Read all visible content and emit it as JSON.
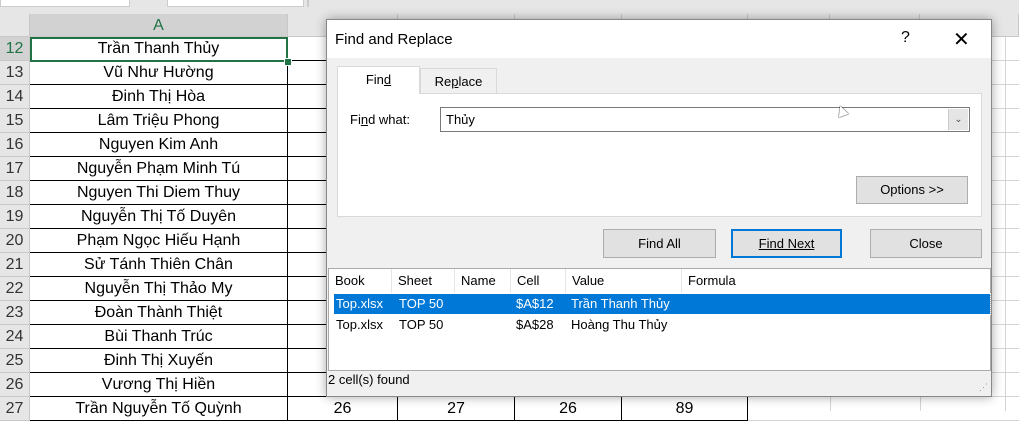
{
  "sheet": {
    "column_header": "A",
    "rows": [
      {
        "num": "12",
        "name": "Trần Thanh Thủy"
      },
      {
        "num": "13",
        "name": "Vũ Như Hường"
      },
      {
        "num": "14",
        "name": "Đinh Thị Hòa"
      },
      {
        "num": "15",
        "name": "Lâm Triệu Phong"
      },
      {
        "num": "16",
        "name": "Nguyen Kim Anh"
      },
      {
        "num": "17",
        "name": "Nguyễn Phạm Minh Tú"
      },
      {
        "num": "18",
        "name": "Nguyen Thi Diem Thuy"
      },
      {
        "num": "19",
        "name": "Nguyễn Thị Tố Duyên"
      },
      {
        "num": "20",
        "name": "Phạm Ngọc Hiếu Hạnh"
      },
      {
        "num": "21",
        "name": "Sử Tánh Thiên Chân"
      },
      {
        "num": "22",
        "name": "Nguyễn Thị Thảo My"
      },
      {
        "num": "23",
        "name": "Đoàn Thành Thiệt"
      },
      {
        "num": "24",
        "name": "Bùi Thanh Trúc"
      },
      {
        "num": "25",
        "name": "Đinh Thị Xuyến"
      },
      {
        "num": "26",
        "name": "Vương Thị Hiền"
      },
      {
        "num": "27",
        "name": "Trần Nguyễn Tố Quỳnh",
        "b": "26",
        "c": "27",
        "d": "26",
        "e": "89"
      }
    ]
  },
  "dialog": {
    "title": "Find and Replace",
    "help": "?",
    "close_glyph": "✕",
    "tabs": {
      "find_pre": "Fin",
      "find_u": "d",
      "replace_pre": "Re",
      "replace_u": "p",
      "replace_post": "lace"
    },
    "find_label_pre": "Fi",
    "find_label_u": "n",
    "find_label_post": "d what:",
    "find_value": "Thủy",
    "options": "Options >>",
    "find_all": "Find All",
    "find_next": "Find Next",
    "close": "Close",
    "columns": [
      "Book",
      "Sheet",
      "Name",
      "Cell",
      "Value",
      "Formula"
    ],
    "results": [
      {
        "book": "Top.xlsx",
        "sheet": "TOP 50",
        "name": "",
        "cell": "$A$12",
        "value": "Trần Thanh Thủy",
        "formula": ""
      },
      {
        "book": "Top.xlsx",
        "sheet": "TOP 50",
        "name": "",
        "cell": "$A$28",
        "value": "Hoàng Thu Thủy",
        "formula": ""
      }
    ],
    "status": "2 cell(s) found"
  }
}
